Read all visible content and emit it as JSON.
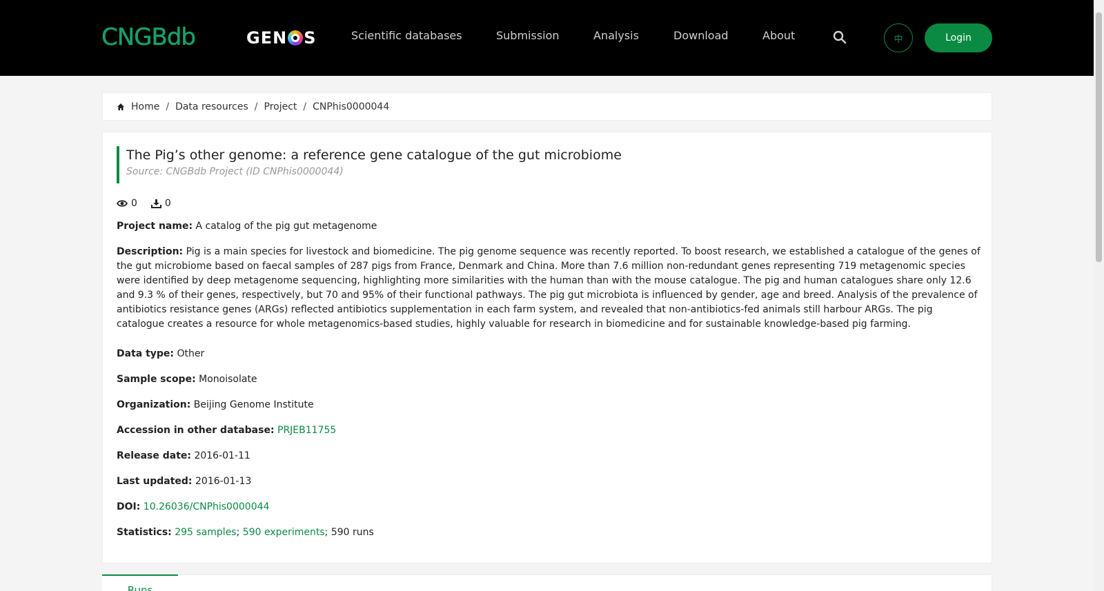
{
  "header": {
    "logo_cngb": "CNGBdb",
    "logo_genos_pre": "GEN",
    "logo_genos_post": "S",
    "nav": [
      "Scientific databases",
      "Submission",
      "Analysis",
      "Download",
      "About"
    ],
    "lang_label": "中",
    "login_label": "Login"
  },
  "breadcrumb": [
    "Home",
    "Data resources",
    "Project",
    "CNPhis0000044"
  ],
  "project": {
    "title": "The Pig’s other genome: a reference gene catalogue of the gut microbiome",
    "source": "Source: CNGBdb Project (ID CNPhis0000044)",
    "views": "0",
    "downloads": "0",
    "name_label": "Project name:",
    "name": "A catalog of the pig gut metagenome",
    "description_label": "Description:",
    "description": "Pig is a main species for livestock and biomedicine. The pig genome sequence was recently reported. To boost research, we established a catalogue of the genes of the gut microbiome based on faecal samples of 287 pigs from France, Denmark and China. More than 7.6 million non-redundant genes representing 719 metagenomic species were identified by deep metagenome sequencing, highlighting more similarities with the human than with the mouse catalogue. The pig and human catalogues share only 12.6 and 9.3 % of their genes, respectively, but 70 and 95% of their functional pathways. The pig gut microbiota is influenced by gender, age and breed. Analysis of the prevalence of antibiotics resistance genes (ARGs) reflected antibiotics supplementation in each farm system, and revealed that non-antibiotics-fed animals still harbour ARGs. The pig catalogue creates a resource for whole metagenomics-based studies, highly valuable for research in biomedicine and for sustainable knowledge-based pig farming.",
    "data_type_label": "Data type:",
    "data_type": "Other",
    "sample_scope_label": "Sample scope:",
    "sample_scope": "Monoisolate",
    "organization_label": "Organization:",
    "organization": "Beijing Genome Institute",
    "accession_label": "Accession in other database:",
    "accession": "PRJEB11755",
    "release_label": "Release date:",
    "release": "2016-01-11",
    "updated_label": "Last updated:",
    "updated": "2016-01-13",
    "doi_label": "DOI:",
    "doi": "10.26036/CNPhis0000044",
    "statistics_label": "Statistics:",
    "samples": "295 samples",
    "experiments": "590 experiments",
    "runs": "590 runs"
  },
  "tabs": [
    "Runs"
  ],
  "colors": {
    "brand_green": "#0a8a43",
    "header_bg": "#000000"
  }
}
